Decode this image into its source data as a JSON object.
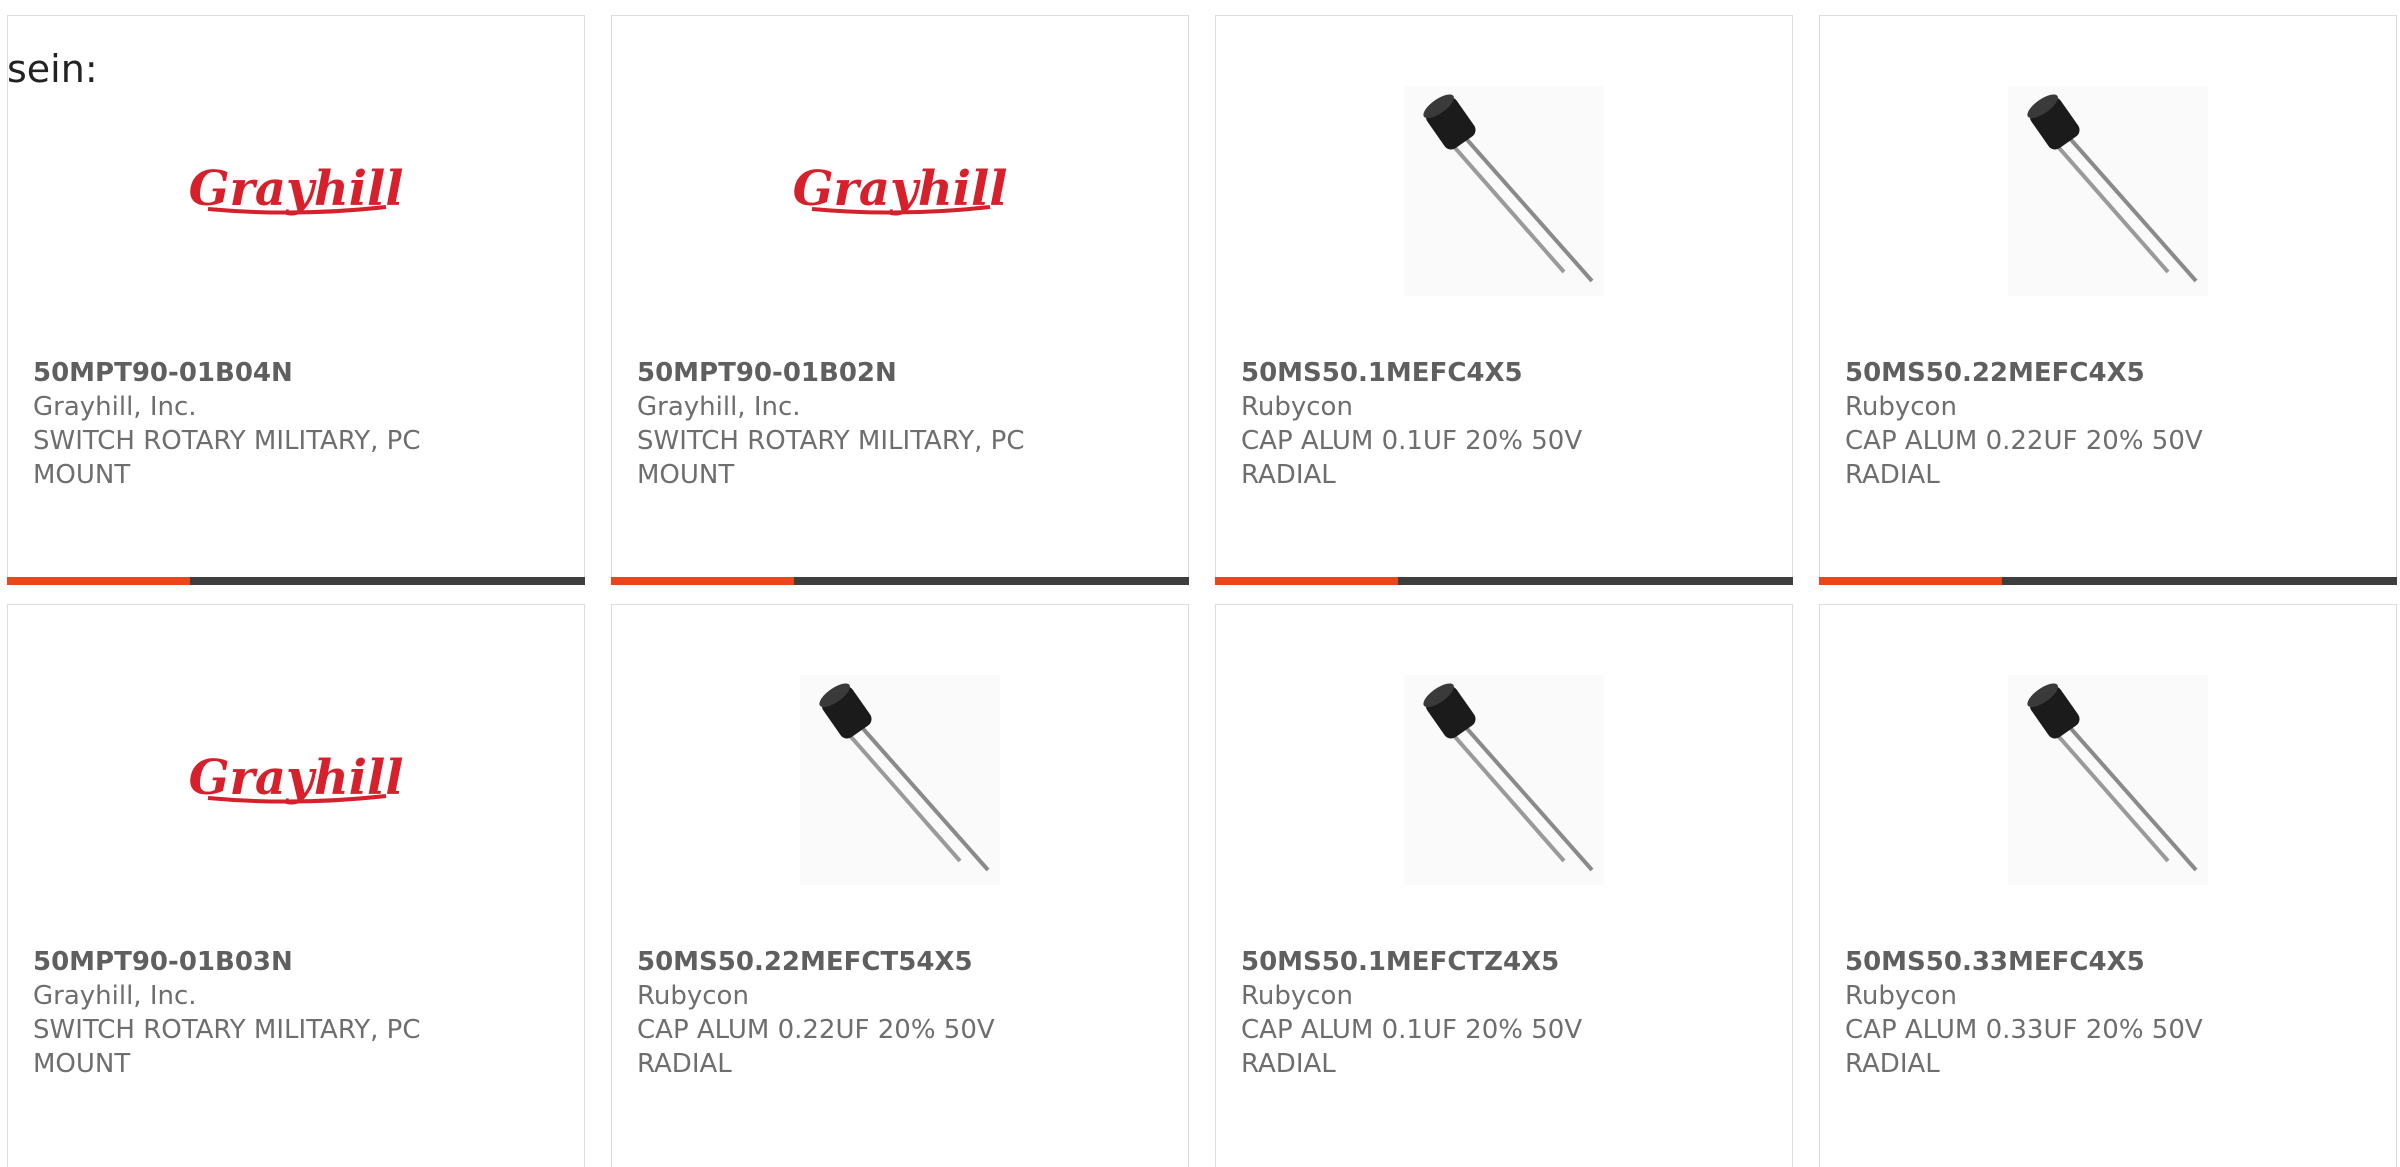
{
  "prefix_text": "sein:",
  "colors": {
    "accent": "#e8471c",
    "bar": "#3e3e3e",
    "text": "#6e6e6e",
    "brand_red": "#d6202b"
  },
  "products": [
    {
      "part_number": "50MPT90-01B04N",
      "manufacturer": "Grayhill, Inc.",
      "description": "SWITCH ROTARY MILITARY, PC MOUNT",
      "image": "grayhill-logo",
      "logo_text": "Grayhill"
    },
    {
      "part_number": "50MPT90-01B02N",
      "manufacturer": "Grayhill, Inc.",
      "description": "SWITCH ROTARY MILITARY, PC MOUNT",
      "image": "grayhill-logo",
      "logo_text": "Grayhill"
    },
    {
      "part_number": "50MS50.1MEFC4X5",
      "manufacturer": "Rubycon",
      "description": "CAP ALUM 0.1UF 20% 50V RADIAL",
      "image": "capacitor-photo"
    },
    {
      "part_number": "50MS50.22MEFC4X5",
      "manufacturer": "Rubycon",
      "description": "CAP ALUM 0.22UF 20% 50V RADIAL",
      "image": "capacitor-photo"
    },
    {
      "part_number": "50MPT90-01B03N",
      "manufacturer": "Grayhill, Inc.",
      "description": "SWITCH ROTARY MILITARY, PC MOUNT",
      "image": "grayhill-logo",
      "logo_text": "Grayhill"
    },
    {
      "part_number": "50MS50.22MEFCT54X5",
      "manufacturer": "Rubycon",
      "description": "CAP ALUM 0.22UF 20% 50V RADIAL",
      "image": "capacitor-photo"
    },
    {
      "part_number": "50MS50.1MEFCTZ4X5",
      "manufacturer": "Rubycon",
      "description": "CAP ALUM 0.1UF 20% 50V RADIAL",
      "image": "capacitor-photo"
    },
    {
      "part_number": "50MS50.33MEFC4X5",
      "manufacturer": "Rubycon",
      "description": "CAP ALUM 0.33UF 20% 50V RADIAL",
      "image": "capacitor-photo"
    }
  ]
}
